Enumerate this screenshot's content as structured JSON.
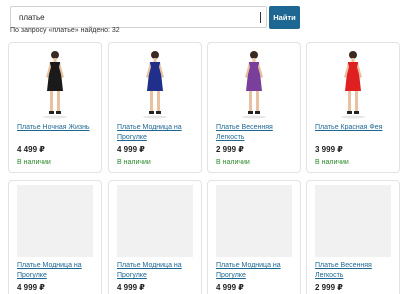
{
  "search": {
    "query": "платье",
    "button_label": "Найти"
  },
  "result_summary": "По запросу «платье» найдено: 32",
  "currency": "₽",
  "products": [
    {
      "name": "Платье Ночная Жизнь",
      "price": "4 499 ₽",
      "stock": "В наличии",
      "dress_color": "#1a1a1a",
      "has_image": true
    },
    {
      "name": "Платье Модница на Прогулке",
      "price": "4 999 ₽",
      "stock": "В наличии",
      "dress_color": "#1f2f8a",
      "has_image": true
    },
    {
      "name": "Платье Весенняя Легкость",
      "price": "2 999 ₽",
      "stock": "В наличии",
      "dress_color": "#7a3f9a",
      "has_image": true
    },
    {
      "name": "Платье Красная Фея",
      "price": "3 999 ₽",
      "stock": "В наличии",
      "dress_color": "#e02020",
      "has_image": true
    },
    {
      "name": "Платье Модница на Прогулке",
      "price": "4 999 ₽",
      "stock": "",
      "dress_color": "",
      "has_image": false
    },
    {
      "name": "Платье Модница на Прогулке",
      "price": "4 999 ₽",
      "stock": "",
      "dress_color": "",
      "has_image": false
    },
    {
      "name": "Платье Модница на Прогулке",
      "price": "4 999 ₽",
      "stock": "",
      "dress_color": "",
      "has_image": false
    },
    {
      "name": "Платье Весенняя Легкость",
      "price": "2 999 ₽",
      "stock": "",
      "dress_color": "",
      "has_image": false
    }
  ]
}
